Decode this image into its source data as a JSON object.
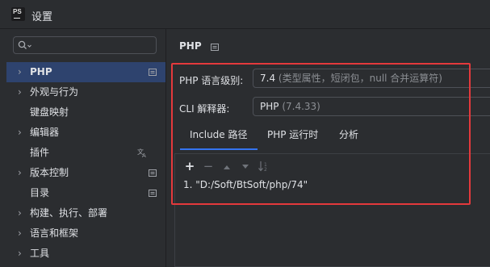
{
  "window": {
    "title": "设置"
  },
  "sidebar": {
    "search_placeholder": "",
    "items": [
      {
        "label": "PHP",
        "has_chevron": true,
        "icon": "settings-scope-icon"
      },
      {
        "label": "外观与行为",
        "has_chevron": true
      },
      {
        "label": "键盘映射",
        "has_chevron": false
      },
      {
        "label": "编辑器",
        "has_chevron": true
      },
      {
        "label": "插件",
        "has_chevron": false,
        "icon": "translate-icon"
      },
      {
        "label": "版本控制",
        "has_chevron": true,
        "icon": "settings-scope-icon"
      },
      {
        "label": "目录",
        "has_chevron": false,
        "icon": "settings-scope-icon"
      },
      {
        "label": "构建、执行、部署",
        "has_chevron": true
      },
      {
        "label": "语言和框架",
        "has_chevron": true
      },
      {
        "label": "工具",
        "has_chevron": true
      }
    ]
  },
  "main": {
    "title": "PHP",
    "language_level": {
      "label": "PHP 语言级别:",
      "value": "7.4",
      "hint": "(类型属性，短闭包，null 合并运算符)"
    },
    "cli_interpreter": {
      "label": "CLI 解释器:",
      "value": "PHP",
      "hint": "(7.4.33)"
    },
    "tabs": [
      "Include 路径",
      "PHP 运行时",
      "分析"
    ],
    "active_tab": 0,
    "include_paths": [
      "1. \"D:/Soft/BtSoft/php/74\""
    ]
  },
  "colors": {
    "accent": "#3574f0",
    "selection": "#2e436e",
    "highlight_box": "#e4393c"
  }
}
